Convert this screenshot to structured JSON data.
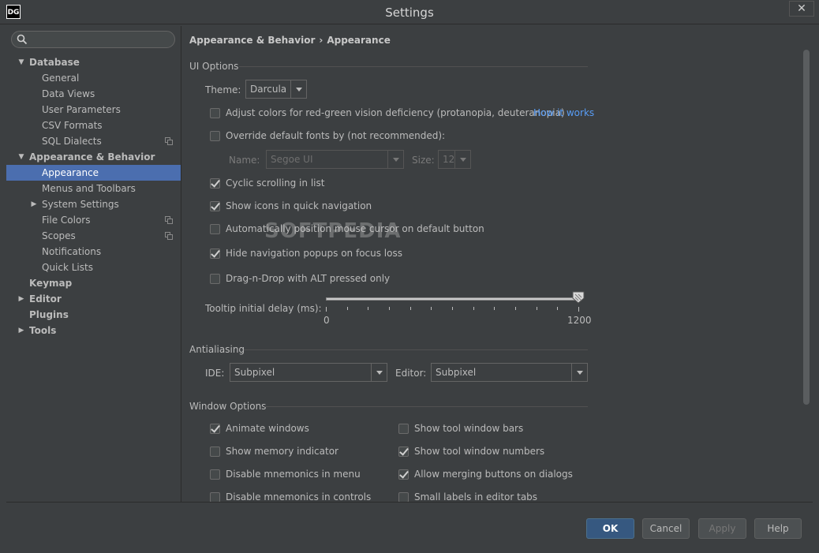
{
  "window": {
    "icon_text": "DG",
    "title": "Settings",
    "close_glyph": "✕"
  },
  "sidebar": {
    "search": {
      "placeholder": "",
      "value": ""
    },
    "tree": [
      {
        "label": "Database",
        "level": 0,
        "expanded": true,
        "bold": true
      },
      {
        "label": "General",
        "level": 1
      },
      {
        "label": "Data Views",
        "level": 1
      },
      {
        "label": "User Parameters",
        "level": 1
      },
      {
        "label": "CSV Formats",
        "level": 1
      },
      {
        "label": "SQL Dialects",
        "level": 1,
        "copy_icon": true
      },
      {
        "label": "Appearance & Behavior",
        "level": 0,
        "expanded": true,
        "bold": true
      },
      {
        "label": "Appearance",
        "level": 1,
        "selected": true
      },
      {
        "label": "Menus and Toolbars",
        "level": 1
      },
      {
        "label": "System Settings",
        "level": 1,
        "expandable": true
      },
      {
        "label": "File Colors",
        "level": 1,
        "copy_icon": true
      },
      {
        "label": "Scopes",
        "level": 1,
        "copy_icon": true
      },
      {
        "label": "Notifications",
        "level": 1
      },
      {
        "label": "Quick Lists",
        "level": 1
      },
      {
        "label": "Keymap",
        "level": 0,
        "bold": true
      },
      {
        "label": "Editor",
        "level": 0,
        "expandable": true,
        "bold": true
      },
      {
        "label": "Plugins",
        "level": 0,
        "bold": true
      },
      {
        "label": "Tools",
        "level": 0,
        "expandable": true,
        "bold": true
      }
    ]
  },
  "breadcrumb": {
    "parent": "Appearance & Behavior",
    "separator": "›",
    "current": "Appearance"
  },
  "ui_options": {
    "title": "UI Options",
    "theme_label": "Theme:",
    "theme_value": "Darcula",
    "adjust_colors": {
      "label": "Adjust colors for red-green vision deficiency (protanopia, deuteranopia)",
      "checked": false
    },
    "how_it_works": "How it works",
    "override_fonts": {
      "label": "Override default fonts by (not recommended):",
      "checked": false
    },
    "font_name_label": "Name:",
    "font_name_value": "Segoe UI",
    "font_size_label": "Size:",
    "font_size_value": "12",
    "cyclic_scrolling": {
      "label": "Cyclic scrolling in list",
      "checked": true
    },
    "show_icons": {
      "label": "Show icons in quick navigation",
      "checked": true
    },
    "auto_position": {
      "label": "Automatically position mouse cursor on default button",
      "checked": false
    },
    "hide_popups": {
      "label": "Hide navigation popups on focus loss",
      "checked": true
    },
    "drag_n_drop": {
      "label": "Drag-n-Drop with ALT pressed only",
      "checked": false
    },
    "tooltip_label": "Tooltip initial delay (ms):",
    "tooltip_min": "0",
    "tooltip_max": "1200",
    "tooltip_value_fraction": 1.0
  },
  "antialiasing": {
    "title": "Antialiasing",
    "ide_label": "IDE:",
    "ide_value": "Subpixel",
    "editor_label": "Editor:",
    "editor_value": "Subpixel"
  },
  "window_options": {
    "title": "Window Options",
    "animate_windows": {
      "label": "Animate windows",
      "checked": true
    },
    "show_memory": {
      "label": "Show memory indicator",
      "checked": false
    },
    "disable_mnemonics_menu": {
      "label": "Disable mnemonics in menu",
      "checked": false
    },
    "disable_mnemonics_controls": {
      "label": "Disable mnemonics in controls",
      "checked": false
    },
    "show_tool_bars": {
      "label": "Show tool window bars",
      "checked": false
    },
    "show_tool_numbers": {
      "label": "Show tool window numbers",
      "checked": true
    },
    "allow_merging": {
      "label": "Allow merging buttons on dialogs",
      "checked": true
    },
    "small_labels": {
      "label": "Small labels in editor tabs",
      "checked": false
    }
  },
  "buttons": {
    "ok": "OK",
    "cancel": "Cancel",
    "apply": "Apply",
    "help": "Help"
  },
  "watermark": "SOFTPEDIA",
  "colors": {
    "selection": "#4b6eaf",
    "link": "#589df6",
    "background": "#3c3f41",
    "default_button": "#365880"
  }
}
